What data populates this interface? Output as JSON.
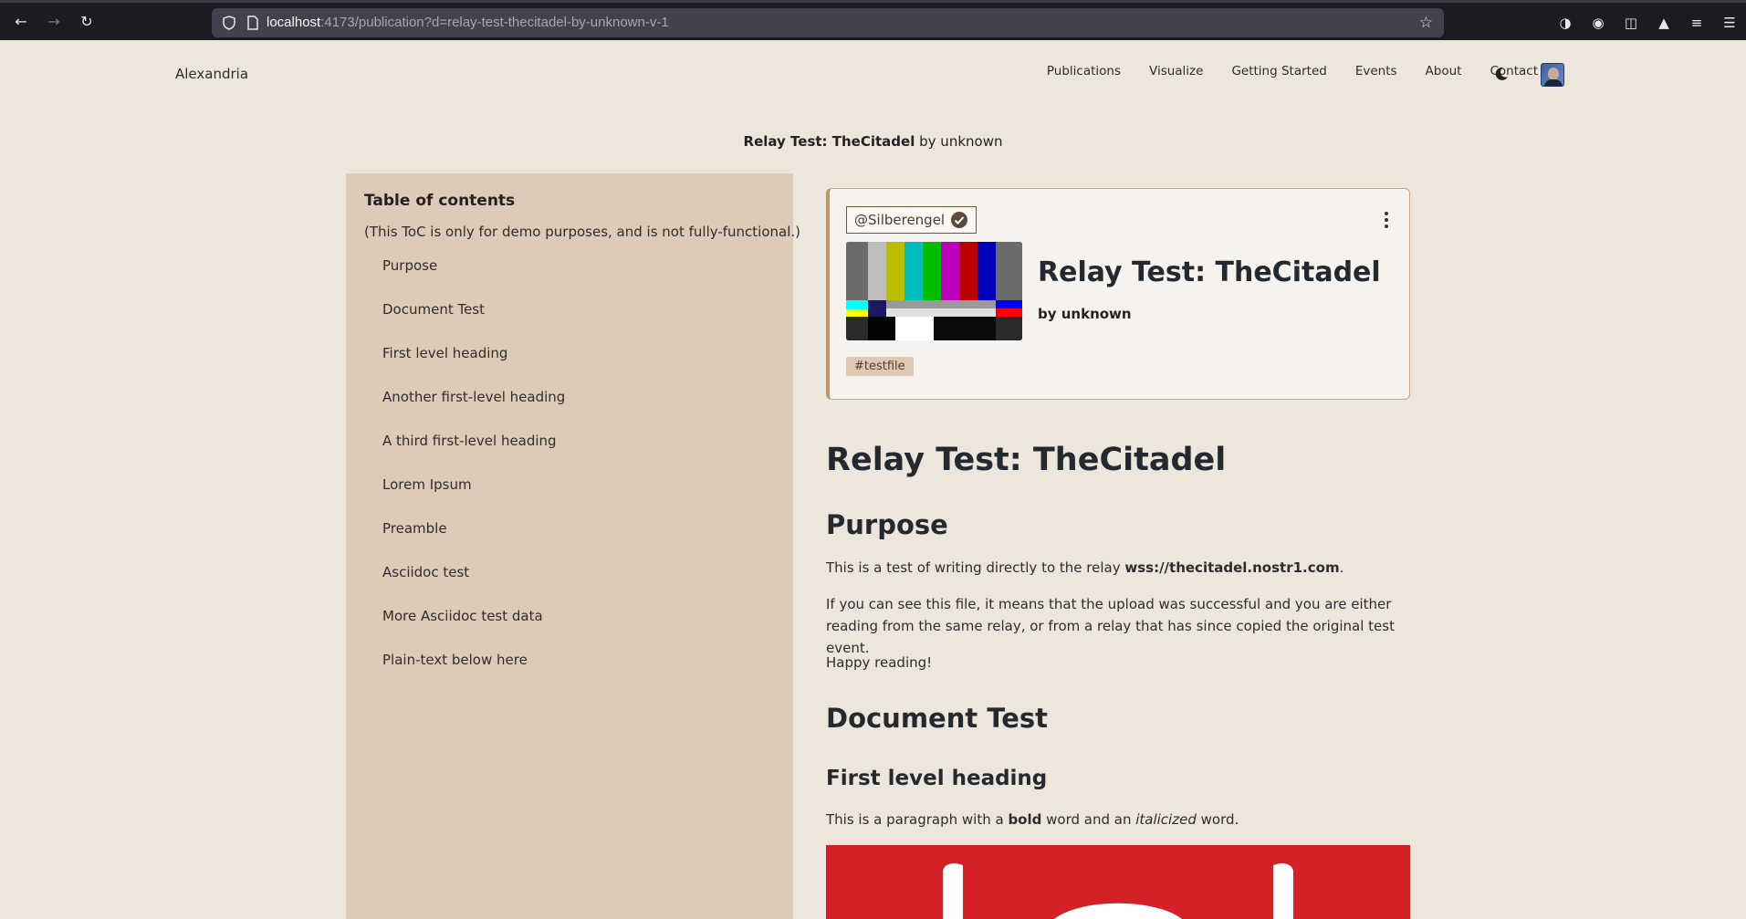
{
  "browser": {
    "url_host": "localhost",
    "url_rest": ":4173/publication?d=relay-test-thecitadel-by-unknown-v-1"
  },
  "site": {
    "brand": "Alexandria",
    "nav": [
      "Publications",
      "Visualize",
      "Getting Started",
      "Events",
      "About",
      "Contact"
    ]
  },
  "publication_header": {
    "title": "Relay Test: TheCitadel",
    "by": "by unknown"
  },
  "toc": {
    "heading": "Table of contents",
    "note": "(This ToC is only for demo purposes, and is not fully-functional.)",
    "items": [
      "Purpose",
      "Document Test",
      "First level heading",
      "Another first-level heading",
      "A third first-level heading",
      "Lorem Ipsum",
      "Preamble",
      "Asciidoc test",
      "More Asciidoc test data",
      "Plain-text below here"
    ]
  },
  "card": {
    "handle": "@Silberengel",
    "title": "Relay Test: TheCitadel",
    "author": "by unknown",
    "tag": "#testfile"
  },
  "doc": {
    "title": "Relay Test: TheCitadel",
    "purpose_heading": "Purpose",
    "purpose_p1_prefix": "This is a test of writing directly to the relay ",
    "purpose_p1_bold": "wss://thecitadel.nostr1.com",
    "purpose_p1_suffix": ".",
    "purpose_p2": "If you can see this file, it means that the upload was successful and you are either reading from the same relay, or from a relay that has since copied the original test event.",
    "purpose_p3": "Happy reading!",
    "doc_test_heading": "Document Test",
    "first_level_heading": "First level heading",
    "para_prefix": "This is a paragraph with a ",
    "para_bold": "bold",
    "para_mid": " word and an ",
    "para_italic": "italicized",
    "para_suffix": " word."
  },
  "colors": {
    "page_bg": "#ede6dc",
    "toc_bg": "#ddcbb7",
    "card_border": "#b99571",
    "image_red": "#d62027"
  }
}
